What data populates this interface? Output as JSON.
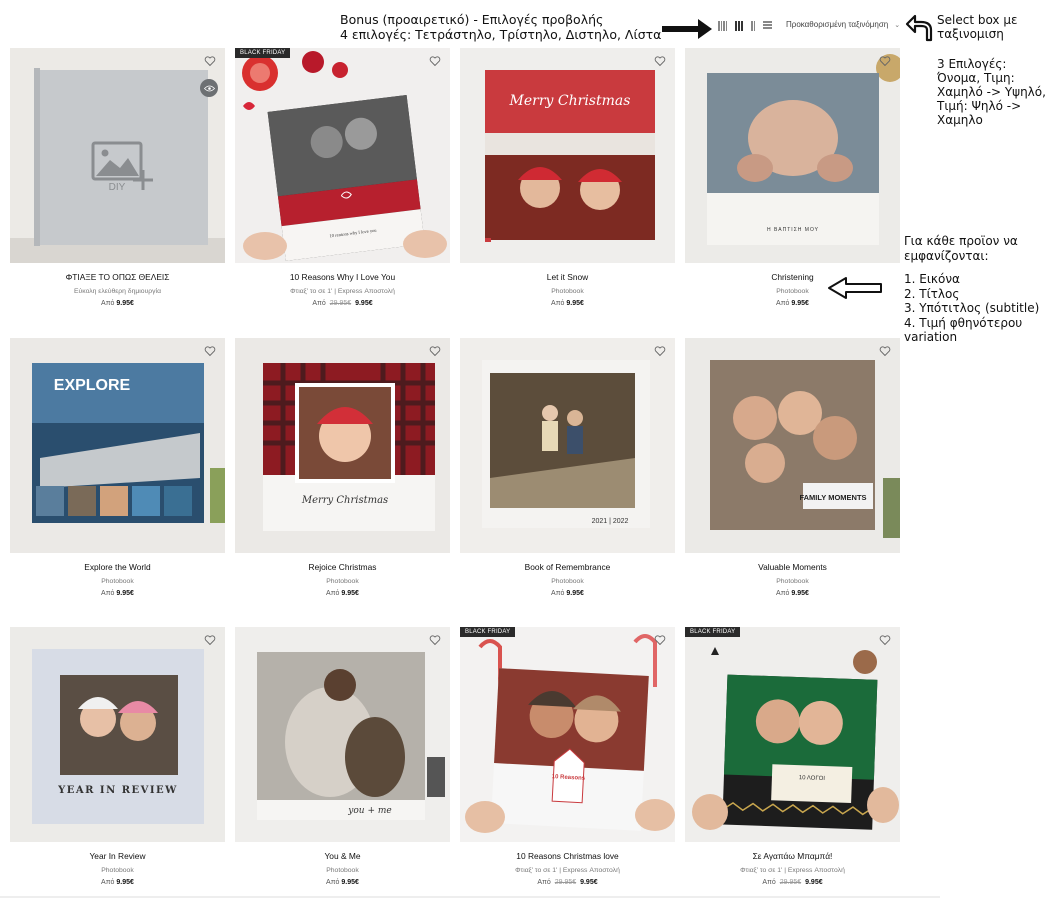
{
  "toolbar": {
    "annotation_line1": "Bonus (προαιρετικό) - Επιλογές προβολής",
    "annotation_line2": "4 επιλογές: Τετράστηλο, Τρίστηλο, Διστηλο, Λίστα",
    "view_options": [
      "four-columns",
      "three-columns",
      "two-columns",
      "list"
    ],
    "sort_label": "Προκαθορισμένη ταξινόμηση",
    "select_note_line1": "Select box με",
    "select_note_line2": "ταξινομιση",
    "sort_options_note": [
      "3 Επιλογές:",
      "Όνομα, Τιμη:",
      "Χαμηλό -> Υψηλό,",
      "Τιμή: Ψηλό ->",
      "Χαμηλο"
    ]
  },
  "product_note": {
    "heading_line1": "Για κάθε προϊον να",
    "heading_line2": "εμφανίζονται:",
    "items": [
      "1. Εικόνα",
      "2. Τίτλος",
      "3. Υπότιτλος (subtitle)",
      "4. Τιμή φθηνότερου",
      "variation"
    ]
  },
  "colors": {
    "accent": "#c8102e",
    "badge": "#2a2a2a",
    "text": "#111111",
    "muted": "#777777"
  },
  "products": [
    {
      "title": "ΦΤΙΑΞΕ ΤΟ ΟΠΩΣ ΘΕΛΕΙΣ",
      "subtitle": "Εύκολη ελεύθερη δημιουργία",
      "from": "Από",
      "old_price": "",
      "price": "9.95€",
      "badge": "",
      "cover_text": "DIY"
    },
    {
      "title": "10 Reasons Why I Love You",
      "subtitle": "Φτιαξ' το σε 1' | Express Αποστολή",
      "from": "Από",
      "old_price": "29.95€",
      "price": "9.95€",
      "badge": "BLACK FRIDAY",
      "cover_text": "10 reasons why I love you"
    },
    {
      "title": "Let it Snow",
      "subtitle": "Photobook",
      "from": "Από",
      "old_price": "",
      "price": "9.95€",
      "badge": "",
      "cover_text": "Merry Christmas"
    },
    {
      "title": "Christening",
      "subtitle": "Photobook",
      "from": "Από",
      "old_price": "",
      "price": "9.95€",
      "badge": "",
      "cover_text": "Η ΒΑΠΤΙΣΗ ΜΟΥ"
    },
    {
      "title": "Explore the World",
      "subtitle": "Photobook",
      "from": "Από",
      "old_price": "",
      "price": "9.95€",
      "badge": "",
      "cover_text": "EXPLORE"
    },
    {
      "title": "Rejoice Christmas",
      "subtitle": "Photobook",
      "from": "Από",
      "old_price": "",
      "price": "9.95€",
      "badge": "",
      "cover_text": "Merry Christmas"
    },
    {
      "title": "Book of Remembrance",
      "subtitle": "Photobook",
      "from": "Από",
      "old_price": "",
      "price": "9.95€",
      "badge": "",
      "cover_text": "2021 | 2022"
    },
    {
      "title": "Valuable Moments",
      "subtitle": "Photobook",
      "from": "Από",
      "old_price": "",
      "price": "9.95€",
      "badge": "",
      "cover_text": "FAMILY MOMENTS"
    },
    {
      "title": "Year In Review",
      "subtitle": "Photobook",
      "from": "Από",
      "old_price": "",
      "price": "9.95€",
      "badge": "",
      "cover_text": "YEAR IN REVIEW"
    },
    {
      "title": "You & Me",
      "subtitle": "Photobook",
      "from": "Από",
      "old_price": "",
      "price": "9.95€",
      "badge": "",
      "cover_text": "you + me"
    },
    {
      "title": "10 Reasons Christmas love",
      "subtitle": "Φτιαξ' το σε 1' | Express Αποστολή",
      "from": "Από",
      "old_price": "29.95€",
      "price": "9.95€",
      "badge": "BLACK FRIDAY",
      "cover_text": "10 Reasons"
    },
    {
      "title": "Σε Αγαπάω Μπαμπά!",
      "subtitle": "Φτιαξ' το σε 1' | Express Αποστολή",
      "from": "Από",
      "old_price": "29.95€",
      "price": "9.95€",
      "badge": "BLACK FRIDAY",
      "cover_text": "10 ΛΟΓΟΙ"
    }
  ]
}
